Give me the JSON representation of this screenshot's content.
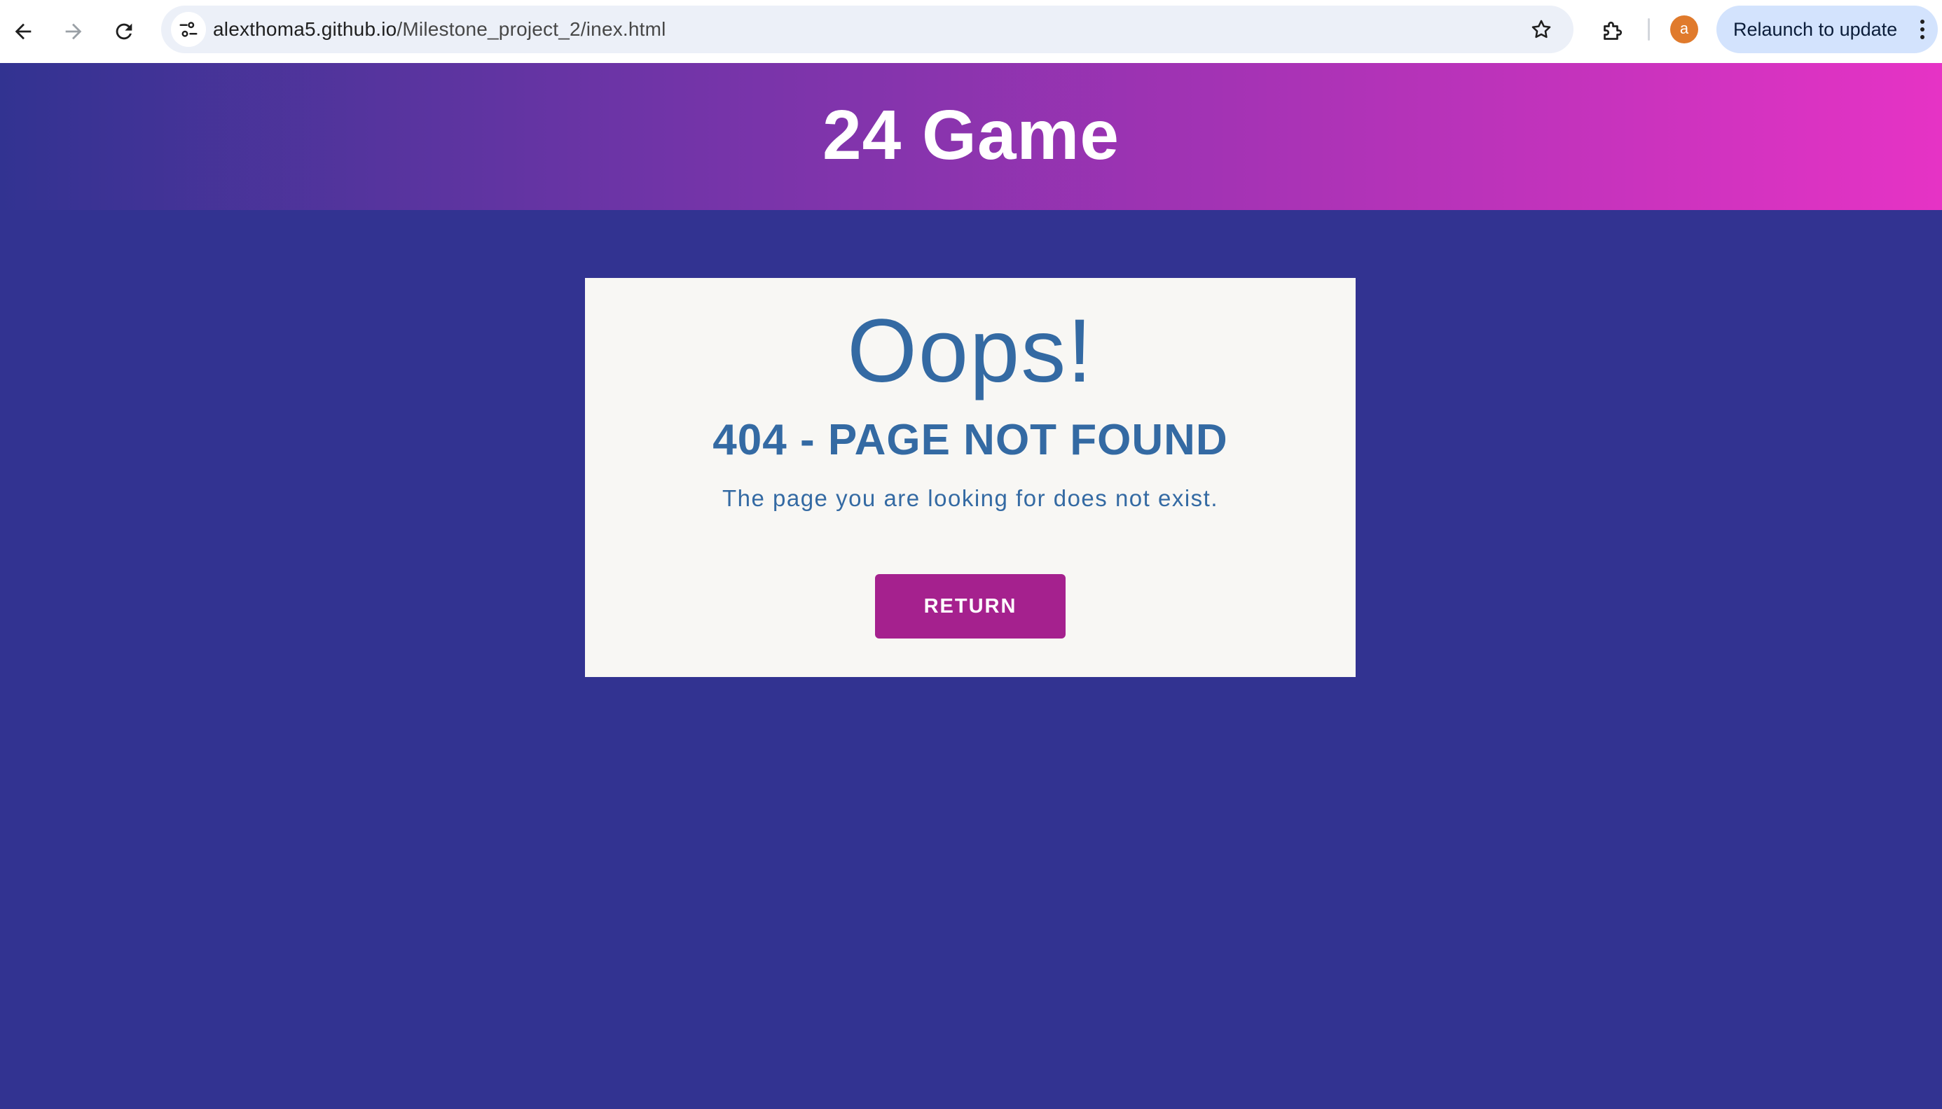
{
  "browser": {
    "url_host": "alexthoma5.github.io",
    "url_path": "/Milestone_project_2/inex.html",
    "profile_initial": "a",
    "relaunch_label": "Relaunch to update",
    "icons": {
      "back": "arrow-left-icon",
      "forward": "arrow-right-icon",
      "reload": "reload-icon",
      "site_info": "tune-icon",
      "bookmark": "star-icon",
      "extensions": "puzzle-icon",
      "menu": "kebab-menu-icon"
    }
  },
  "site": {
    "title": "24 Game"
  },
  "error": {
    "heading": "Oops!",
    "subheading": "404 - PAGE NOT FOUND",
    "message": "The page you are looking for does not exist.",
    "return_label": "RETURN"
  },
  "colors": {
    "page_background": "#323391",
    "header_gradient_start": "#323391",
    "header_gradient_end": "#e633c5",
    "card_background": "#f8f7f4",
    "card_text": "#346aa3",
    "button_background": "#a5218e",
    "relaunch_background": "#d3e3fd",
    "avatar_background": "#e07a2c"
  }
}
